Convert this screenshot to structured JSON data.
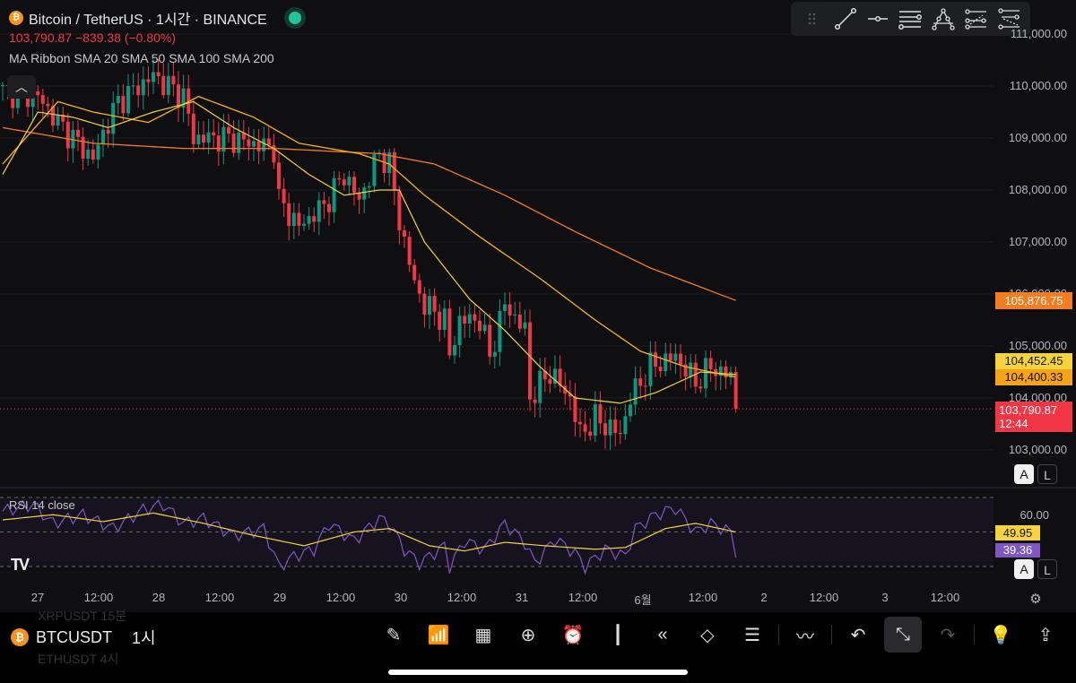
{
  "header": {
    "title": "Bitcoin / TetherUS · 1시간 · BINANCE",
    "price_line": "103,790.87  −839.38 (−0.80%)",
    "indicator": "MA Ribbon SMA 20 SMA 50 SMA 100 SMA 200",
    "collapse_icon": "chevron-up"
  },
  "price_axis": {
    "labels": [
      "111,000.00",
      "110,000.00",
      "109,000.00",
      "108,000.00",
      "107,000.00",
      "106,000.00",
      "105,000.00",
      "104,000.00",
      "103,000.00"
    ],
    "tags": {
      "sma200": "105,876.75",
      "sma20": "104,452.45",
      "sma50": "104,400.33",
      "last": "103,790.87",
      "countdown": "12:44"
    },
    "auto": "A",
    "log": "L"
  },
  "rsi": {
    "label": "RSI 14 close",
    "axis": "60.00",
    "rsi_tag": "39.36",
    "ma_tag": "49.95",
    "auto": "A",
    "log": "L"
  },
  "time_axis": [
    "27",
    "12:00",
    "28",
    "12:00",
    "29",
    "12:00",
    "30",
    "12:00",
    "31",
    "12:00",
    "6월",
    "12:00",
    "2",
    "12:00",
    "3",
    "12:00"
  ],
  "logo": "TV",
  "colors": {
    "up": "#089981",
    "down": "#f23645",
    "sma20": "#f5d33a",
    "sma50": "#f7b318",
    "sma200": "#f57c1f",
    "rsi": "#7e57c2"
  },
  "chart_data": {
    "type": "candlestick",
    "ylim": [
      102600,
      111300
    ],
    "close_anchors": [
      [
        0,
        109900
      ],
      [
        7,
        109800
      ],
      [
        11,
        109300
      ],
      [
        18,
        108600
      ],
      [
        20,
        109100
      ],
      [
        23,
        109700
      ],
      [
        30,
        110200
      ],
      [
        36,
        109800
      ],
      [
        38,
        109000
      ],
      [
        45,
        109000
      ],
      [
        54,
        108800
      ],
      [
        55,
        107800
      ],
      [
        59,
        107300
      ],
      [
        64,
        107700
      ],
      [
        68,
        108300
      ],
      [
        71,
        107800
      ],
      [
        75,
        108700
      ],
      [
        77,
        108500
      ],
      [
        79,
        107400
      ],
      [
        82,
        106200
      ],
      [
        84,
        105800
      ],
      [
        88,
        105500
      ],
      [
        89,
        104800
      ],
      [
        91,
        105500
      ],
      [
        95,
        105500
      ],
      [
        97,
        104800
      ],
      [
        100,
        105800
      ],
      [
        104,
        105300
      ],
      [
        105,
        104000
      ],
      [
        109,
        104500
      ],
      [
        113,
        104000
      ],
      [
        115,
        103300
      ],
      [
        118,
        103600
      ],
      [
        123,
        103300
      ],
      [
        125,
        104000
      ],
      [
        129,
        104600
      ],
      [
        134,
        104800
      ],
      [
        138,
        104300
      ],
      [
        141,
        104600
      ],
      [
        145,
        104400
      ],
      [
        146,
        103790
      ]
    ],
    "sma20": [
      [
        0,
        108300
      ],
      [
        7,
        109500
      ],
      [
        14,
        109400
      ],
      [
        21,
        109200
      ],
      [
        30,
        109500
      ],
      [
        38,
        109700
      ],
      [
        46,
        109200
      ],
      [
        54,
        108800
      ],
      [
        61,
        108300
      ],
      [
        68,
        107900
      ],
      [
        75,
        108000
      ],
      [
        79,
        108000
      ],
      [
        84,
        107000
      ],
      [
        93,
        105900
      ],
      [
        100,
        105300
      ],
      [
        107,
        104600
      ],
      [
        114,
        104000
      ],
      [
        123,
        103900
      ],
      [
        130,
        104100
      ],
      [
        139,
        104500
      ],
      [
        146,
        104450
      ]
    ],
    "sma50": [
      [
        0,
        108500
      ],
      [
        11,
        109700
      ],
      [
        18,
        109500
      ],
      [
        29,
        109300
      ],
      [
        39,
        109800
      ],
      [
        50,
        109400
      ],
      [
        59,
        108900
      ],
      [
        71,
        108700
      ],
      [
        77,
        108500
      ],
      [
        84,
        107900
      ],
      [
        95,
        107100
      ],
      [
        107,
        106300
      ],
      [
        118,
        105500
      ],
      [
        127,
        104900
      ],
      [
        136,
        104600
      ],
      [
        146,
        104400
      ]
    ],
    "sma200": [
      [
        0,
        109200
      ],
      [
        18,
        108900
      ],
      [
        36,
        108800
      ],
      [
        54,
        108800
      ],
      [
        75,
        108700
      ],
      [
        86,
        108500
      ],
      [
        100,
        107900
      ],
      [
        114,
        107200
      ],
      [
        129,
        106500
      ],
      [
        146,
        105876
      ]
    ],
    "rsi_anchors": [
      [
        0,
        62
      ],
      [
        6,
        66
      ],
      [
        10,
        55
      ],
      [
        16,
        60
      ],
      [
        22,
        52
      ],
      [
        28,
        63
      ],
      [
        32,
        66
      ],
      [
        36,
        55
      ],
      [
        40,
        58
      ],
      [
        46,
        48
      ],
      [
        52,
        52
      ],
      [
        55,
        30
      ],
      [
        58,
        36
      ],
      [
        62,
        40
      ],
      [
        65,
        55
      ],
      [
        70,
        45
      ],
      [
        75,
        58
      ],
      [
        77,
        55
      ],
      [
        80,
        40
      ],
      [
        83,
        32
      ],
      [
        88,
        42
      ],
      [
        89,
        30
      ],
      [
        92,
        45
      ],
      [
        96,
        40
      ],
      [
        100,
        55
      ],
      [
        104,
        44
      ],
      [
        106,
        32
      ],
      [
        110,
        46
      ],
      [
        114,
        38
      ],
      [
        116,
        30
      ],
      [
        120,
        40
      ],
      [
        124,
        36
      ],
      [
        126,
        52
      ],
      [
        130,
        60
      ],
      [
        134,
        64
      ],
      [
        138,
        50
      ],
      [
        141,
        55
      ],
      [
        145,
        50
      ],
      [
        146,
        39
      ]
    ],
    "rsi_ma_anchors": [
      [
        0,
        57
      ],
      [
        10,
        60
      ],
      [
        20,
        56
      ],
      [
        30,
        61
      ],
      [
        40,
        55
      ],
      [
        50,
        48
      ],
      [
        60,
        42
      ],
      [
        70,
        50
      ],
      [
        77,
        52
      ],
      [
        85,
        42
      ],
      [
        92,
        39
      ],
      [
        100,
        44
      ],
      [
        108,
        42
      ],
      [
        118,
        40
      ],
      [
        124,
        41
      ],
      [
        132,
        52
      ],
      [
        138,
        55
      ],
      [
        146,
        50
      ]
    ]
  },
  "bottom": {
    "symbol": "BTCUSDT",
    "interval": "1시",
    "ghost_above": "XRPUSDT   15분",
    "ghost_below": "ETHUSDT   4시"
  },
  "toolbar": [
    "pencil-icon",
    "indicators-icon",
    "grid-icon",
    "plus-circle-icon",
    "alarm-icon",
    "candles-icon",
    "replay-icon",
    "layers-icon",
    "settings-sliders-icon",
    "patterns-icon",
    "undo-icon",
    "collapse-icon",
    "redo-icon",
    "idea-icon",
    "share-icon"
  ]
}
